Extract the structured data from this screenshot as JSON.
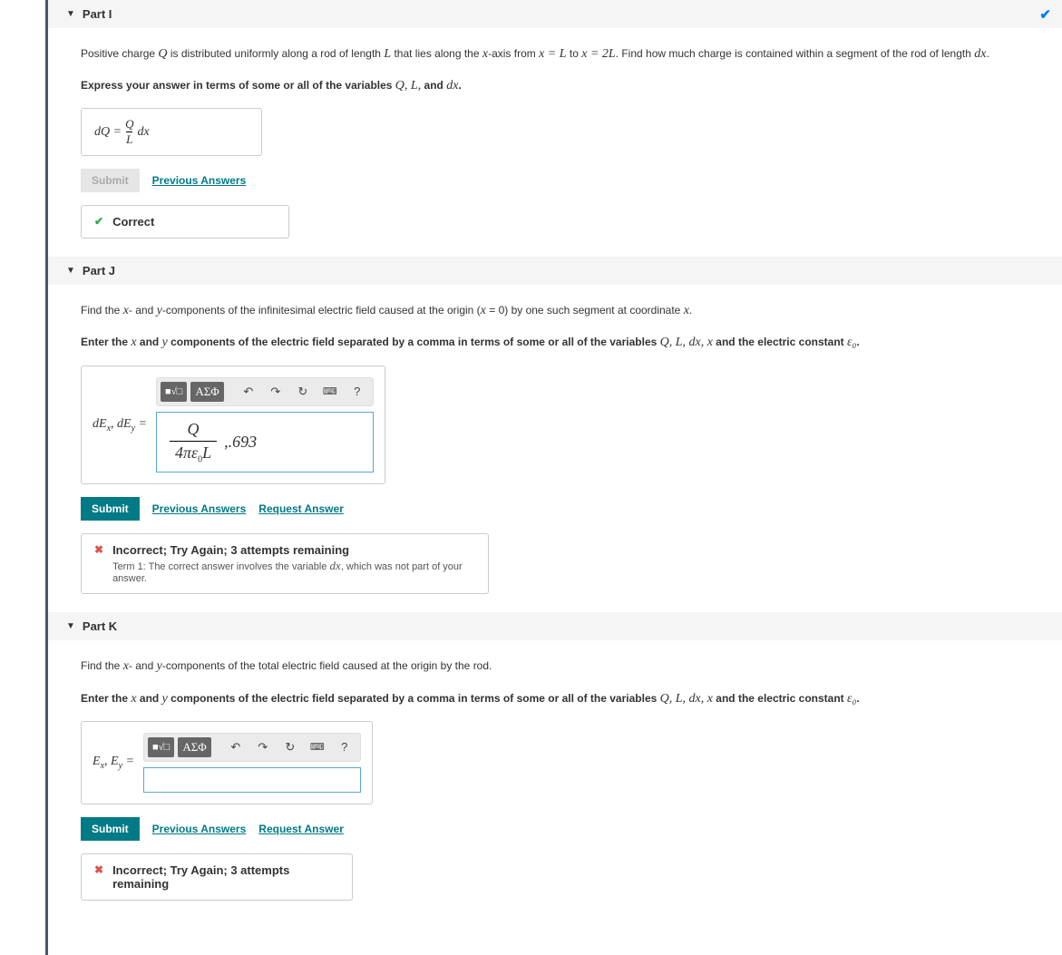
{
  "partI": {
    "title": "Part I",
    "prompt1": "Positive charge ",
    "promptQ": "Q",
    "prompt2": " is distributed uniformly along a rod of length ",
    "promptL": "L",
    "prompt3": " that lies along the ",
    "promptx": "x",
    "prompt4": "-axis from ",
    "prompteq1": "x = L",
    "prompt5": " to ",
    "prompteq2": "x = 2L",
    "prompt6": ". Find how much charge is contained within a segment of the rod of length ",
    "promptdx": "dx",
    "prompt7": ".",
    "express": "Express your answer in terms of some or all of the variables ",
    "vars": "Q, L,",
    "express2": " and ",
    "vars2": "dx",
    "express3": ".",
    "lhs": "dQ = ",
    "fracNum": "Q",
    "fracDen": "L",
    "rhs_tail": "dx",
    "submitLabel": "Submit",
    "prevLabel": "Previous Answers",
    "feedback": "Correct"
  },
  "partJ": {
    "title": "Part J",
    "prompt": "Find the x- and y-components of the infinitesimal electric field caused at the origin (x = 0) by one such segment at coordinate x.",
    "enter1": "Enter the ",
    "enterx": "x",
    "enter2": " and ",
    "entery": "y",
    "enter3": " components of the electric field separated by a comma in terms of some or all of the variables ",
    "vars": "Q, L, dx, x",
    "enter4": " and the electric constant ",
    "eps": "ε₀",
    "enter5": ".",
    "label_lhs": "dE",
    "label_sub1": "x",
    "label_mid": ", dE",
    "label_sub2": "y",
    "label_eq": " = ",
    "ans_num": "Q",
    "ans_den": "4πε₀L",
    "ans_tail": ",.693",
    "submitLabel": "Submit",
    "prevLabel": "Previous Answers",
    "reqLabel": "Request Answer",
    "feedback_title": "Incorrect; Try Again; 3 attempts remaining",
    "feedback_detail1": "Term 1: The correct answer involves the variable ",
    "feedback_var": "dx",
    "feedback_detail2": ", which was not part of your answer."
  },
  "partK": {
    "title": "Part K",
    "prompt": "Find the x- and y-components of the total electric field caused at the origin by the rod.",
    "enter1": "Enter the ",
    "enterx": "x",
    "enter2": " and ",
    "entery": "y",
    "enter3": " components of the electric field separated by a comma in terms of some or all of the variables ",
    "vars": "Q, L, dx, x",
    "enter4": " and the electric constant ",
    "eps": "ε₀",
    "enter5": ".",
    "label_lhs": "E",
    "label_sub1": "x",
    "label_mid": ", E",
    "label_sub2": "y",
    "label_eq": " = ",
    "submitLabel": "Submit",
    "prevLabel": "Previous Answers",
    "reqLabel": "Request Answer",
    "feedback_title": "Incorrect; Try Again; 3 attempts remaining"
  },
  "toolbar": {
    "templates": "■√□",
    "greek": "ΑΣΦ",
    "undo": "↶",
    "redo": "↷",
    "reset": "↻",
    "keyboard": "⌨",
    "help": "?"
  }
}
